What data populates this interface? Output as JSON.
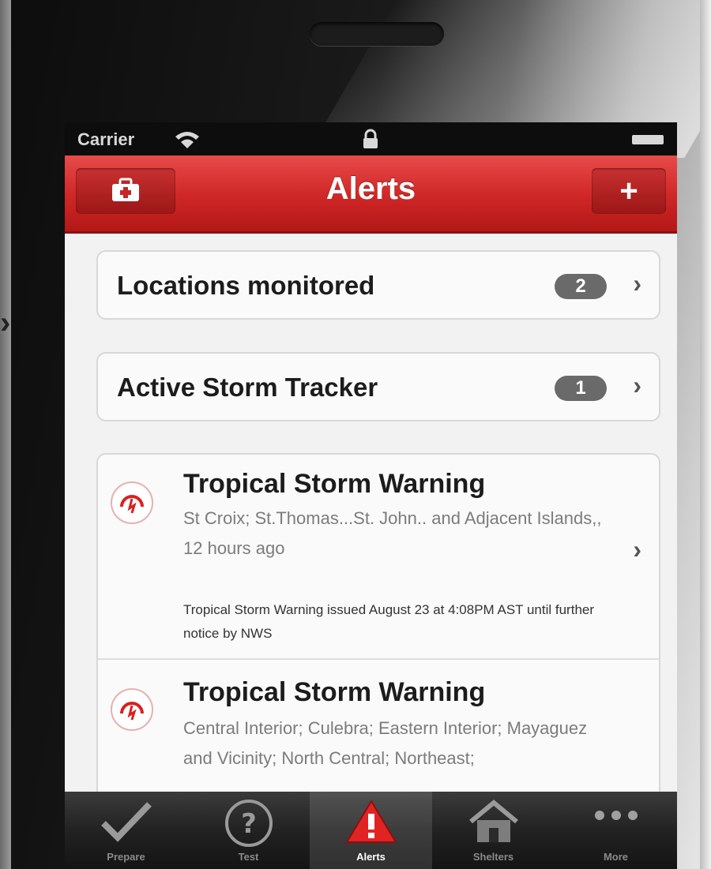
{
  "status_bar": {
    "carrier": "Carrier"
  },
  "nav": {
    "title": "Alerts",
    "right_button": "+"
  },
  "rows": [
    {
      "label": "Locations monitored",
      "count": "2"
    },
    {
      "label": "Active Storm Tracker",
      "count": "1"
    }
  ],
  "alerts": [
    {
      "title": "Tropical Storm Warning",
      "areas": "St Croix; St.Thomas...St. John.. and Adjacent Islands,, 12 hours ago",
      "description": "Tropical Storm Warning issued August 23 at 4:08PM AST until further notice by NWS"
    },
    {
      "title": "Tropical Storm Warning",
      "areas": "Central Interior; Culebra; Eastern Interior; Mayaguez and Vicinity; North Central; Northeast;"
    }
  ],
  "tabs": [
    {
      "label": "Prepare",
      "icon": "checkmark-icon"
    },
    {
      "label": "Test",
      "icon": "question-icon"
    },
    {
      "label": "Alerts",
      "icon": "warning-icon",
      "selected": true
    },
    {
      "label": "Shelters",
      "icon": "house-icon"
    },
    {
      "label": "More",
      "icon": "more-dots-icon"
    }
  ],
  "colors": {
    "nav_red": "#cf2626",
    "alert_icon_red": "#d92020",
    "badge_gray": "#6a6a6a"
  }
}
